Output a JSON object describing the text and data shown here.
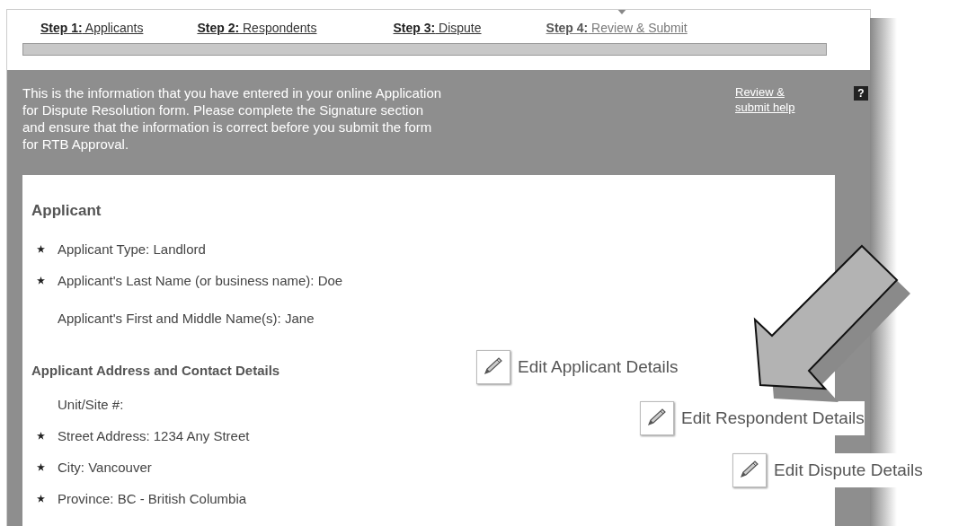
{
  "steps": [
    {
      "label": "**Step 1:** Applicants",
      "selected": false
    },
    {
      "label": "**Step 2:** Respondents",
      "selected": false
    },
    {
      "label": "**Step 3:** Dispute",
      "selected": false
    },
    {
      "label": "**Step 4:** Review & Submit",
      "selected": true
    }
  ],
  "intro": {
    "lines": [
      "This is the information that you have entered in your online Application",
      "for Dispute Resolution form. Please complete the Signature section",
      "and ensure that the information is correct before you submit the form",
      "for RTB Approval."
    ],
    "help_link": "Review & submit help",
    "help_icon": "?"
  },
  "content": [
    {
      "kind": "heading",
      "text": "Applicant"
    },
    {
      "kind": "field",
      "text": "Applicant Type: Landlord",
      "required": true
    },
    {
      "kind": "field",
      "text": "Applicant's Last Name (or business name): Doe",
      "required": true
    },
    {
      "kind": "field",
      "text": "Applicant's First and Middle Name(s): Jane",
      "required": false
    },
    {
      "kind": "subheading",
      "text": "Applicant Address and Contact Details"
    },
    {
      "kind": "field",
      "text": "Unit/Site #:",
      "required": false
    },
    {
      "kind": "field",
      "text": "Street Address: 1234 Any Street",
      "required": true
    },
    {
      "kind": "field",
      "text": "City: Vancouver",
      "required": true
    },
    {
      "kind": "field",
      "text": "Province: BC - British Columbia",
      "required": true
    }
  ],
  "edit_buttons": [
    "Edit Applicant Details",
    "Edit Respondent Details",
    "Edit Dispute Details"
  ]
}
